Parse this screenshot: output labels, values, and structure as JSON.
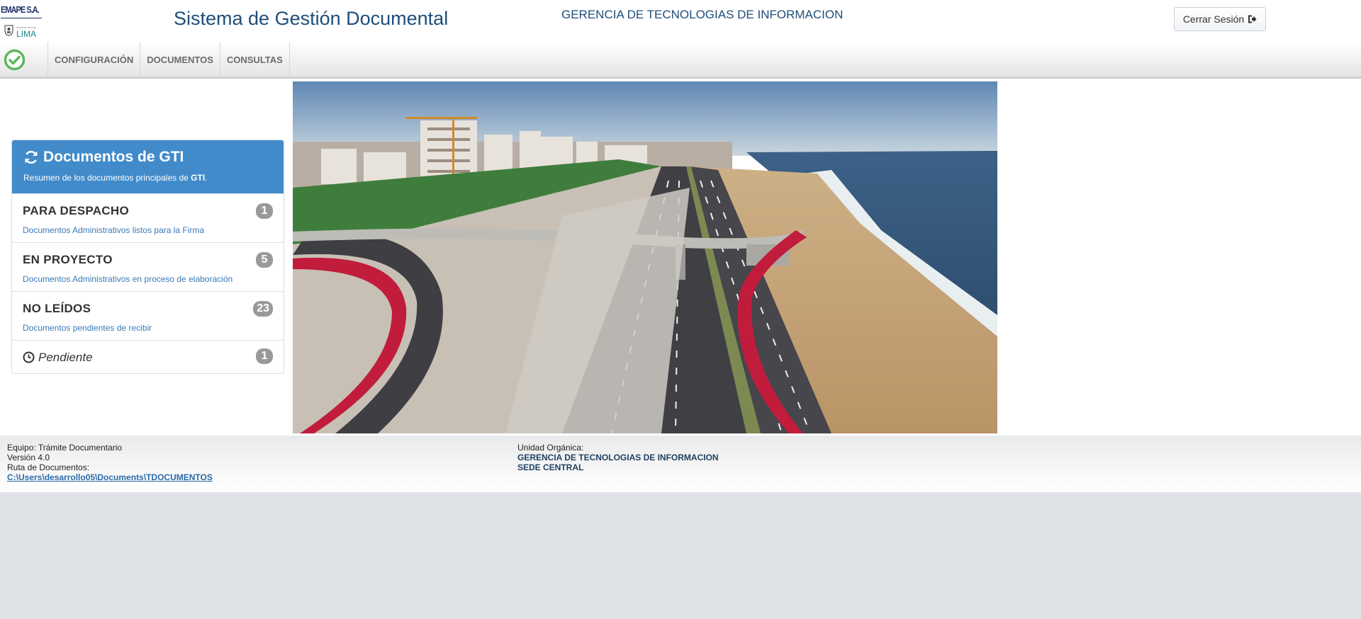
{
  "header": {
    "logo": {
      "brand": "EMAPE S.A.",
      "city": "LIMA",
      "city_small": "MUNICIPALIDAD DE"
    },
    "app_title": "Sistema de Gestión Documental",
    "org_title": "GERENCIA DE TECNOLOGIAS DE INFORMACION",
    "logout_label": "Cerrar Sesión"
  },
  "nav": {
    "items": [
      {
        "label": "CONFIGURACIÓN"
      },
      {
        "label": "DOCUMENTOS"
      },
      {
        "label": "CONSULTAS"
      }
    ]
  },
  "panel": {
    "title": "Documentos de GTI",
    "subtitle": "Resumen de los documentos principales de",
    "subtitle_strong": "GTI",
    "items": [
      {
        "title": "PARA DESPACHO",
        "desc": "Documentos Administrativos listos para la Firma",
        "count": "1"
      },
      {
        "title": "EN PROYECTO",
        "desc": "Documentos Administrativos en proceso de elaboración",
        "count": "5"
      },
      {
        "title": "NO LEÍDOS",
        "desc": "Documentos pendientes de recibir",
        "count": "23"
      }
    ],
    "pending": {
      "label": "Pendiente",
      "count": "1"
    }
  },
  "footer": {
    "team": "Equipo: Trámite Documentario",
    "version": "Versión 4.0",
    "path_label": "Ruta de Documentos:",
    "path": "C:\\Users\\desarrollo05\\Documents\\TDOCUMENTOS",
    "unit_label": "Unidad Orgánica:",
    "unit": "GERENCIA DE TECNOLOGIAS DE INFORMACION",
    "site": "SEDE CENTRAL"
  },
  "colors": {
    "panel_header": "#428bca",
    "title_blue": "#1f4e79",
    "badge": "#999999",
    "check_green": "#5cb85c"
  }
}
